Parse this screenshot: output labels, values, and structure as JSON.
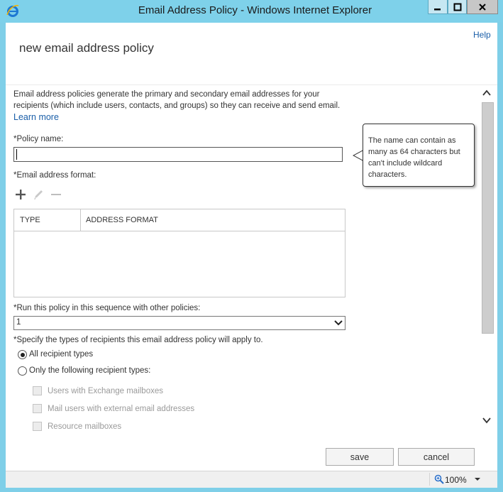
{
  "window": {
    "title": "Email Address Policy - Windows Internet Explorer",
    "minimize_icon": "minimize-icon",
    "maximize_icon": "maximize-icon",
    "close_icon": "close-icon"
  },
  "page": {
    "help_label": "Help",
    "title": "new email address policy",
    "intro_line1": "Email address policies generate the primary and secondary email addresses for your",
    "intro_line2": "recipients (which include users, contacts, and groups) so they can receive and send email.",
    "learn_more": "Learn more"
  },
  "form": {
    "policy_name_label": "*Policy name:",
    "policy_name_value": "",
    "tooltip": "The name can contain as many as 64 characters but can't include wildcard characters.",
    "email_format_label": "*Email address format:",
    "toolbar": [
      "add-icon",
      "edit-icon",
      "remove-icon"
    ],
    "grid_columns": [
      "TYPE",
      "ADDRESS FORMAT"
    ],
    "sequence_label": "*Run this policy in this sequence with other policies:",
    "sequence_value": "1",
    "recipients_label": "*Specify the types of recipients this email address policy will apply to.",
    "radio_all": "All recipient types",
    "radio_only": "Only the following recipient types:",
    "checkboxes": [
      "Users with Exchange mailboxes",
      "Mail users with external email addresses",
      "Resource mailboxes"
    ]
  },
  "buttons": {
    "save": "save",
    "cancel": "cancel"
  },
  "status": {
    "zoom": "100%"
  },
  "colors": {
    "frame": "#7fcfe8",
    "link": "#1a5ea8"
  }
}
